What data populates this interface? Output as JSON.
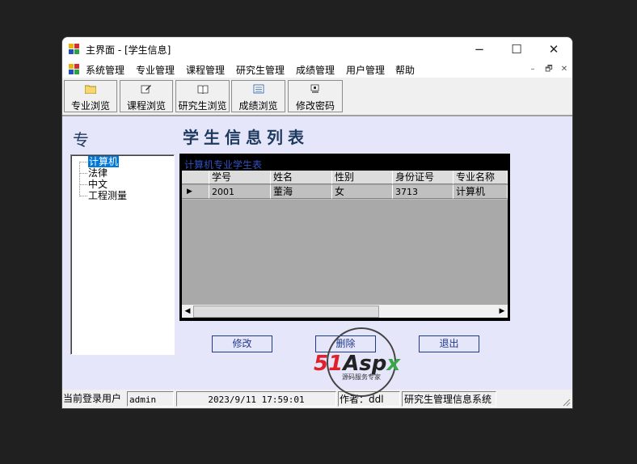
{
  "window": {
    "title": "主界面 - [学生信息]",
    "controls": {
      "minimize": "−",
      "maximize": "☐",
      "close": "✕"
    }
  },
  "menu": {
    "items": [
      "系统管理",
      "专业管理",
      "课程管理",
      "研究生管理",
      "成绩管理",
      "用户管理",
      "帮助"
    ],
    "mdi_controls": {
      "minimize": "–",
      "restore": "🗗",
      "close": "✕"
    }
  },
  "toolbar": {
    "buttons": [
      {
        "label": "专业浏览",
        "icon": "folder-icon"
      },
      {
        "label": "课程浏览",
        "icon": "edit-icon"
      },
      {
        "label": "研究生浏览",
        "icon": "book-icon"
      },
      {
        "label": "成绩浏览",
        "icon": "list-icon"
      },
      {
        "label": "修改密码",
        "icon": "key-icon"
      }
    ]
  },
  "sidebar": {
    "heading": "专",
    "tree": [
      "计算机",
      "法律",
      "中文",
      "工程测量"
    ],
    "selected": "计算机"
  },
  "main": {
    "title": "学生信息列表",
    "grid_caption": "计算机专业学生表",
    "columns": [
      "学号",
      "姓名",
      "性别",
      "身份证号",
      "专业名称"
    ],
    "rows": [
      {
        "indicator": "▶",
        "cells": [
          "2001",
          "董海",
          "女",
          "3713",
          "计算机"
        ]
      }
    ],
    "scroll_left": "◀",
    "scroll_right": "▶"
  },
  "actions": {
    "edit": "修改",
    "delete": "删除",
    "exit": "退出"
  },
  "status": {
    "login_label": "当前登录用户",
    "user": "admin",
    "datetime": "2023/9/11 17:59:01",
    "author": "作者：ddl",
    "system": "研究生管理信息系统"
  },
  "watermark": {
    "brand": "51Aspx",
    "tagline": "源码服务专家"
  },
  "colors": {
    "accent": "#1e3a5f",
    "selection": "#0078d7",
    "mdi_background": "#e6e6fa",
    "watermark_red": "#e0202a",
    "watermark_green": "#3aa64a"
  }
}
